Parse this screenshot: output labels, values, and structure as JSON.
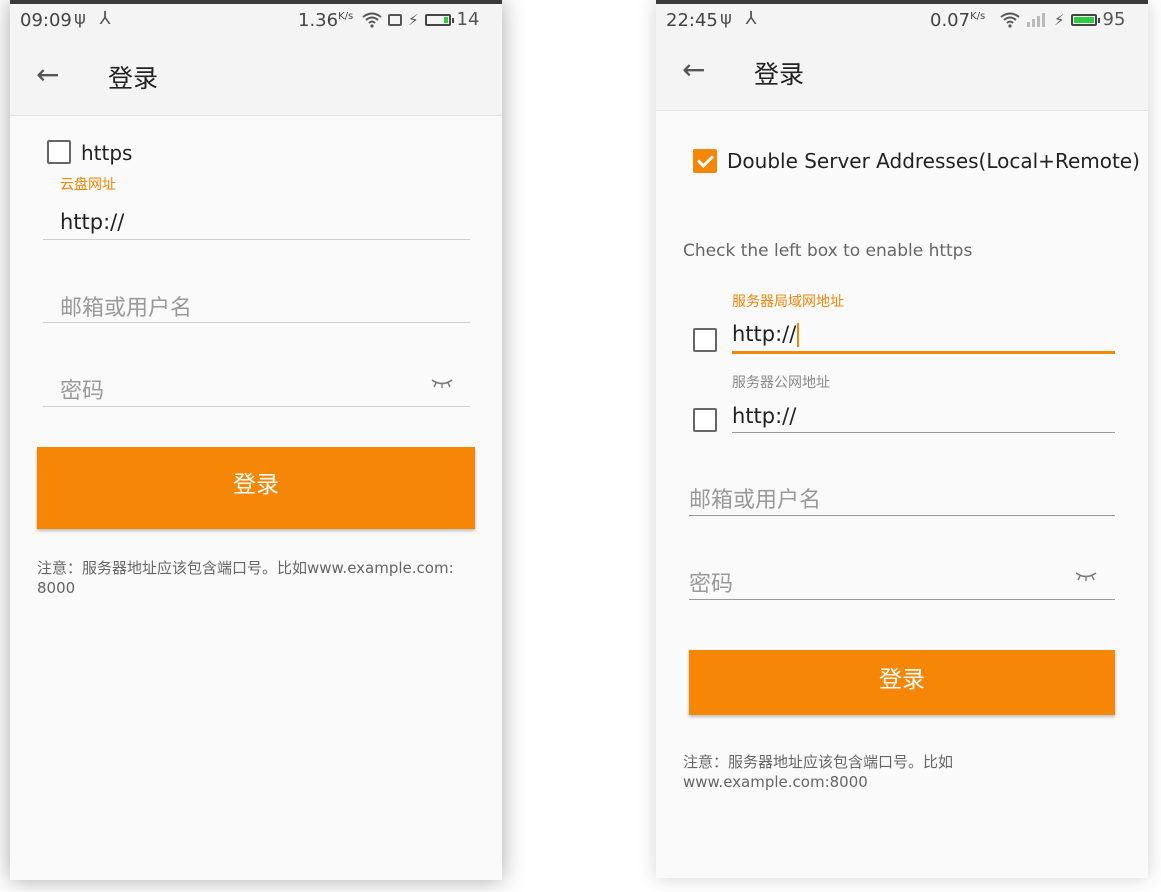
{
  "accent_color": "#f58606",
  "phone_left": {
    "status": {
      "time": "09:09",
      "icons": "ψ ⅄",
      "speed": "1.36",
      "speed_unit": "K/s",
      "battery_level": "14"
    },
    "title": "登录",
    "https_label": "https",
    "https_checked": false,
    "server_label": "云盘网址",
    "server_value": "http://",
    "username_placeholder": "邮箱或用户名",
    "password_placeholder": "密码",
    "login_button": "登录",
    "note_line1": "注意：服务器地址应该包含端口号。比如www.example.com:",
    "note_line2": "8000"
  },
  "phone_right": {
    "status": {
      "time": "22:45",
      "icons": "ψ ⅄",
      "speed": "0.07",
      "speed_unit": "K/s",
      "battery_level": "95"
    },
    "title": "登录",
    "double_server_label": "Double Server Addresses(Local+Remote)",
    "double_server_checked": true,
    "https_hint": "Check the left box to enable https",
    "local_label": "服务器局域网地址",
    "local_value": "http://",
    "remote_label": "服务器公网地址",
    "remote_value": "http://",
    "username_placeholder": "邮箱或用户名",
    "password_placeholder": "密码",
    "login_button": "登录",
    "note_line1": "注意：服务器地址应该包含端口号。比如",
    "note_line2": "www.example.com:8000"
  }
}
